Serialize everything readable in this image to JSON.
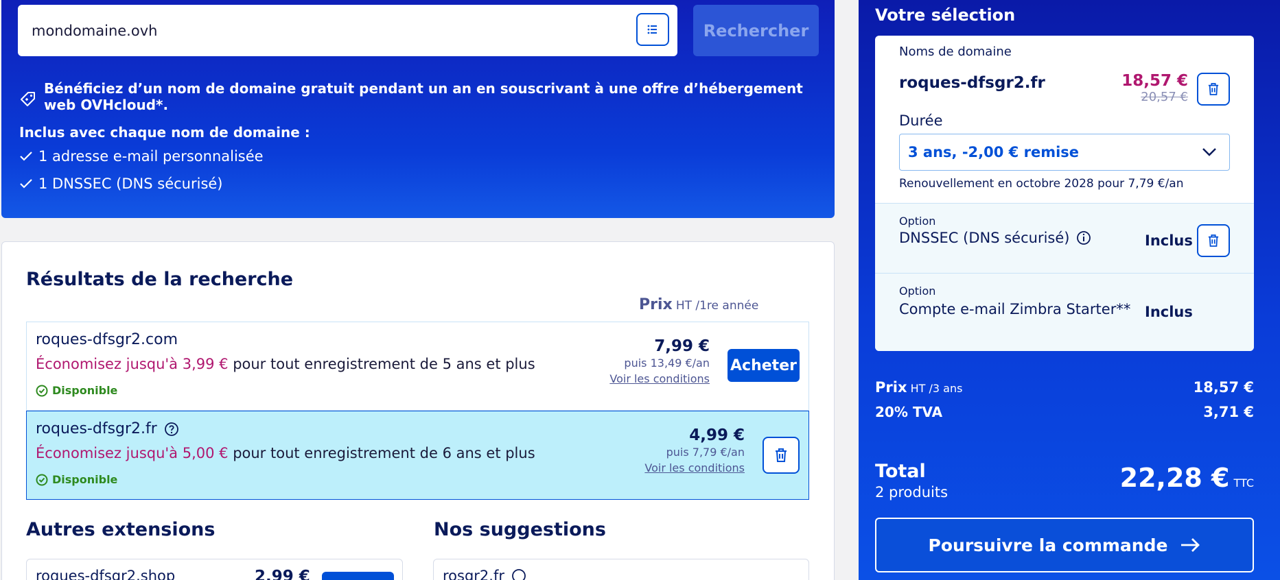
{
  "search": {
    "value": "mondomaine.ovh",
    "button_label": "Rechercher"
  },
  "promo": {
    "text": "Bénéficiez d’un nom de domaine gratuit pendant un an en souscrivant à une offre d’hébergement web OVHcloud*.",
    "included_title": "Inclus avec chaque nom de domaine :",
    "included_items": [
      "1 adresse e-mail personnalisée",
      "1 DNSSEC (DNS sécurisé)"
    ]
  },
  "results": {
    "title": "Résultats de la recherche",
    "price_header": "Prix",
    "price_header_note": "HT /1re année",
    "rows": [
      {
        "domain": "roques-dfsgr2.com",
        "save_accent": "Économisez jusqu'à 3,99 €",
        "save_rest": " pour tout enregistrement de 5 ans et plus",
        "availability": "Disponible",
        "price": "7,99 €",
        "then": "puis 13,49 €/an",
        "conditions": "Voir les conditions",
        "action": "Acheter"
      },
      {
        "domain": "roques-dfsgr2.fr",
        "save_accent": "Économisez jusqu'à 5,00 €",
        "save_rest": " pour tout enregistrement de 6 ans et plus",
        "availability": "Disponible",
        "price": "4,99 €",
        "then": "puis 7,79 €/an",
        "conditions": "Voir les conditions"
      }
    ]
  },
  "other_extensions": {
    "title": "Autres extensions",
    "first_domain": "roques-dfsgr2.shop",
    "first_price": "2,99 €"
  },
  "suggestions": {
    "title": "Nos suggestions",
    "first_domain": "rosgr2.fr"
  },
  "selection": {
    "title": "Votre sélection",
    "domains_label": "Noms de domaine",
    "domain": "roques-dfsgr2.fr",
    "price": "18,57 €",
    "old_price": "20,57 €",
    "duration_label": "Durée",
    "duration_value": "3 ans, -2,00 € remise",
    "renewal": "Renouvellement en octobre 2028 pour 7,79 €/an",
    "options": [
      {
        "label": "Option",
        "name": "DNSSEC (DNS sécurisé)",
        "status": "Inclus"
      },
      {
        "label": "Option",
        "name": "Compte e-mail Zimbra Starter**",
        "status": "Inclus"
      }
    ]
  },
  "summary": {
    "price_label": "Prix",
    "price_note": "HT /3 ans",
    "price_value": "18,57 €",
    "tva_label": "20% TVA",
    "tva_value": "3,71 €",
    "total_label": "Total",
    "products": "2 produits",
    "total_value": "22,28 €",
    "total_note": "TTC",
    "continue_label": "Poursuivre la commande"
  },
  "colors": {
    "brand_blue": "#0050d7",
    "accent_magenta": "#b0176f",
    "available_green": "#2e8a1f",
    "selected_row_bg": "#bdeffb"
  }
}
